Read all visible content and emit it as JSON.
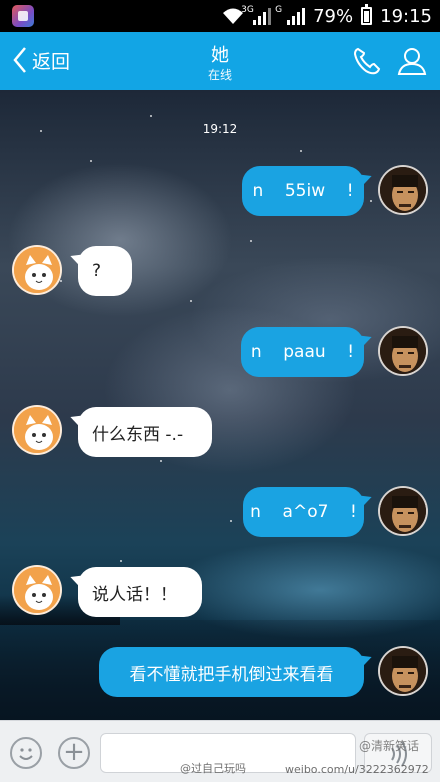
{
  "status_bar": {
    "network_3g": "3G",
    "network_g": "G",
    "battery": "79%",
    "time": "19:15"
  },
  "header": {
    "back_label": "返回",
    "title": "她",
    "subtitle": "在线"
  },
  "chat": {
    "timestamp": "19:12",
    "messages": [
      {
        "side": "mine",
        "text": "n    55iw    !"
      },
      {
        "side": "theirs",
        "text": "?"
      },
      {
        "side": "mine",
        "text": "n    paau    !"
      },
      {
        "side": "theirs",
        "text": "什么东西 -.-"
      },
      {
        "side": "mine",
        "text": "n    a^o7    !"
      },
      {
        "side": "theirs",
        "text": "说人话！！"
      },
      {
        "side": "mine",
        "text": "看不懂就把手机倒过来看看"
      }
    ]
  },
  "input_bar": {
    "plus_symbol": "+",
    "watermark_left": "@过自己玩吗",
    "watermark_url": "weibo.com/u/3222362972",
    "watermark_right": "@清新笑话"
  },
  "colors": {
    "header_bg": "#12a5e5",
    "my_bubble": "#1aa3e2",
    "their_bubble": "#ffffff"
  }
}
